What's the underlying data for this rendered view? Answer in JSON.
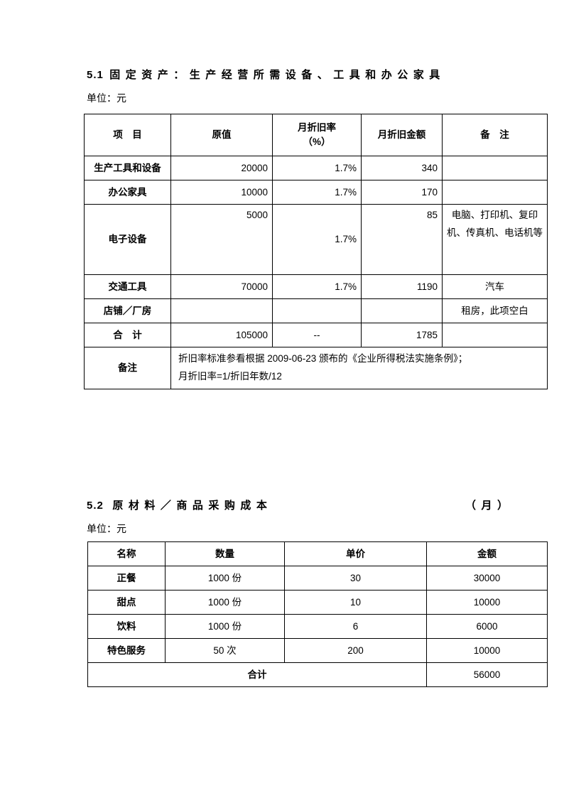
{
  "section1": {
    "number": "5.1",
    "title": "固定资产：生产经营所需设备、工具和办公家具",
    "unit_label": "单位：元",
    "table": {
      "headers": [
        "项　目",
        "月折旧率",
        "（%）",
        "月折旧金额",
        "备　注"
      ],
      "header_col1": "原值",
      "rows": [
        {
          "name": "生产工具和设备",
          "original_value": "20000",
          "rate": "1.7%",
          "amount": "340",
          "note": ""
        },
        {
          "name": "办公家具",
          "original_value": "10000",
          "rate": "1.7%",
          "amount": "170",
          "note": ""
        },
        {
          "name": "电子设备",
          "original_value": "5000",
          "rate": "1.7%",
          "amount": "85",
          "note": "电脑、打印机、复印机、传真机、电话机等"
        },
        {
          "name": "交通工具",
          "original_value": "70000",
          "rate": "1.7%",
          "amount": "1190",
          "note": "汽车"
        },
        {
          "name": "店铺／厂房",
          "original_value": "",
          "rate": "",
          "amount": "",
          "note": "租房，此项空白"
        },
        {
          "name": "合　计",
          "original_value": "105000",
          "rate": "--",
          "amount": "1785",
          "note": ""
        }
      ],
      "footnote_label": "备注",
      "footnote_line1": "折旧率标准参看根据 2009-06-23 颁布的《企业所得税法实施条例》；",
      "footnote_line2": "月折旧率=1/折旧年数/12"
    }
  },
  "section2": {
    "number": "5.2",
    "title": "原材料／商品采购成本",
    "title_right": "（月）",
    "unit_label": "单位：元",
    "table": {
      "headers": [
        "名称",
        "数量",
        "单价",
        "金额"
      ],
      "rows": [
        {
          "name": "正餐",
          "quantity": "1000 份",
          "unit_price": "30",
          "amount": "30000"
        },
        {
          "name": "甜点",
          "quantity": "1000 份",
          "unit_price": "10",
          "amount": "10000"
        },
        {
          "name": "饮料",
          "quantity": "1000 份",
          "unit_price": "6",
          "amount": "6000"
        },
        {
          "name": "特色服务",
          "quantity": "50 次",
          "unit_price": "200",
          "amount": "10000"
        }
      ],
      "total_label": "合计",
      "total_amount": "56000"
    }
  }
}
